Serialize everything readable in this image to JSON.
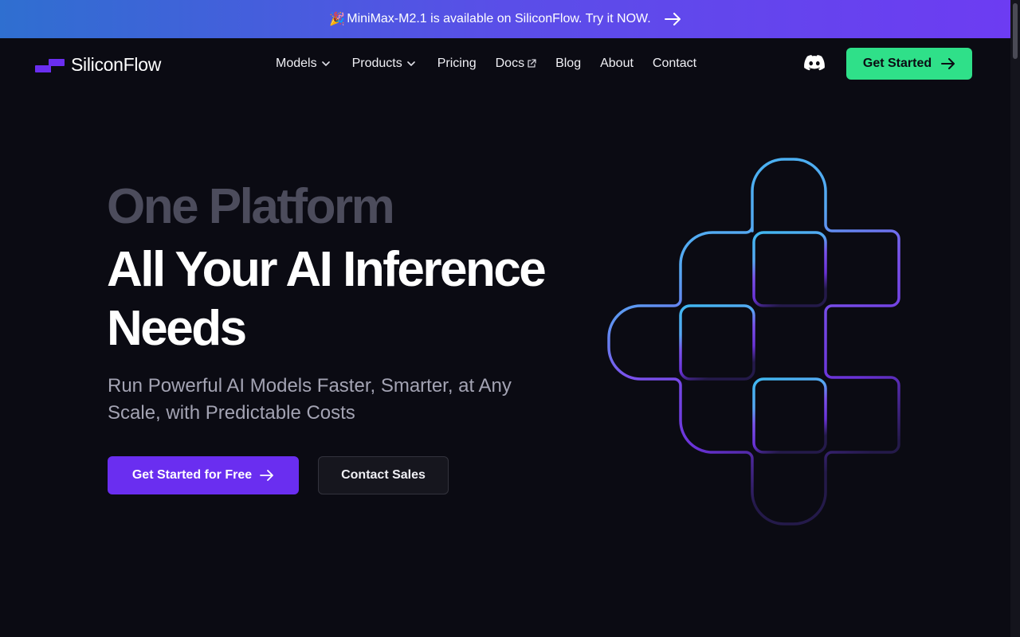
{
  "announcement": {
    "text": "MiniMax-M2.1 is available on SiliconFlow. Try it NOW.",
    "emoji": "🎉"
  },
  "brand": {
    "name": "SiliconFlow"
  },
  "nav": {
    "items": [
      {
        "label": "Models",
        "dropdown": true
      },
      {
        "label": "Products",
        "dropdown": true
      },
      {
        "label": "Pricing"
      },
      {
        "label": "Docs",
        "external": true
      },
      {
        "label": "Blog"
      },
      {
        "label": "About"
      },
      {
        "label": "Contact"
      }
    ],
    "cta_label": "Get Started"
  },
  "hero": {
    "line1": "One Platform",
    "line2": "All Your AI Inference Needs",
    "subtitle": "Run Powerful AI Models Faster, Smarter, at Any Scale,  with Predictable Costs",
    "primary_cta": "Get Started for Free",
    "secondary_cta": "Contact Sales"
  },
  "colors": {
    "background": "#0b0b13",
    "accent_purple": "#6a2ef0",
    "accent_green": "#2fe089",
    "banner_start": "#2f6fd0",
    "banner_end": "#6d3cf2",
    "muted_heading": "#4c4c5c"
  },
  "icons": {
    "logo": "siliconflow-logo-icon",
    "discord": "discord-icon",
    "arrow": "arrow-right-icon",
    "chevron": "chevron-down-icon",
    "external": "external-link-icon"
  }
}
